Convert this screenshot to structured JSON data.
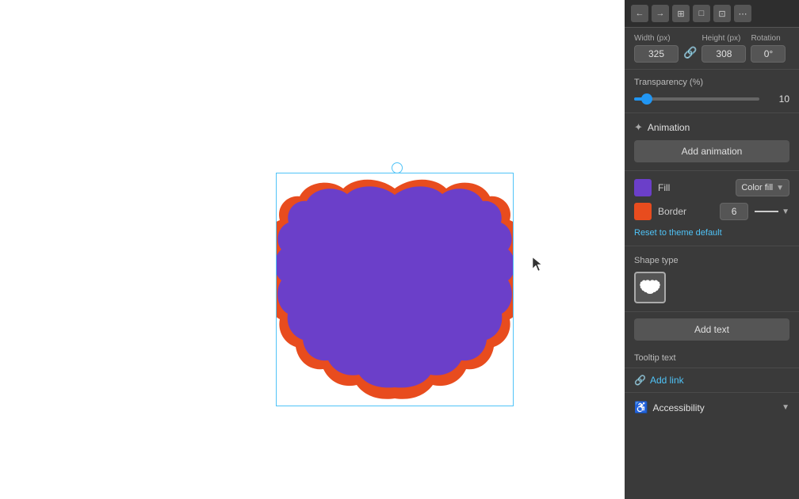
{
  "toolbar": {
    "buttons": [
      "←",
      "→",
      "⊞",
      "⊡",
      "⊠",
      "⊟"
    ]
  },
  "dimensions": {
    "width_label": "Width (px)",
    "height_label": "Height (px)",
    "rotation_label": "Rotation",
    "width_value": "325",
    "height_value": "308",
    "rotation_value": "0°"
  },
  "transparency": {
    "label": "Transparency (%)",
    "value": "10",
    "slider_percent": 10
  },
  "animation": {
    "label": "Animation",
    "add_button": "Add animation"
  },
  "fill": {
    "label": "Fill",
    "color": "#6b3fc9",
    "type": "Color fill"
  },
  "border": {
    "label": "Border",
    "color": "#e84c1e",
    "value": "6"
  },
  "reset_link": "Reset to theme default",
  "shape_type": {
    "label": "Shape type"
  },
  "add_text_button": "Add text",
  "tooltip": {
    "label": "Tooltip text"
  },
  "add_link": {
    "label": "Add link"
  },
  "accessibility": {
    "label": "Accessibility"
  }
}
